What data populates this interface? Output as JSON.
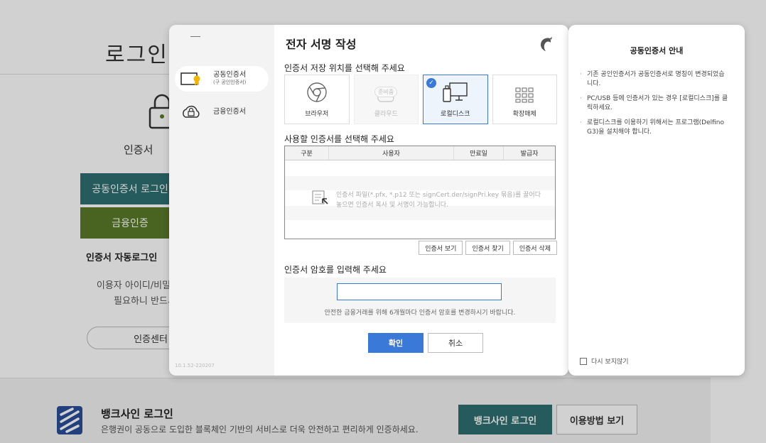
{
  "background": {
    "title": "로그인",
    "cert_label": "인증서",
    "joint_login_btn": "공동인증서 로그인",
    "fin_btn": "금융인증",
    "auto_login": "인증서 자동로그인",
    "desc_line1": "이용자 아이디/비밀번호",
    "desc_line2": "필요하니 반드시 기",
    "center_btn": "인증센터"
  },
  "banksign": {
    "title": "뱅크사인 로그인",
    "desc": "은행권이 공동으로 도입한 블록체인 기반의 서비스로 더욱 안전하고 편리하게 인증하세요.",
    "login_btn": "뱅크사인 로그인",
    "howto_btn": "이용방법 보기"
  },
  "sidebar": {
    "items": [
      {
        "label": "공동인증서",
        "sub": "(구 공인인증서)",
        "icon": "certificate-icon",
        "active": true
      },
      {
        "label": "금융인증서",
        "sub": "",
        "icon": "cloud-lock-icon",
        "active": false
      }
    ],
    "version": "10.1.52-220207"
  },
  "dialog": {
    "title": "전자 서명 작성",
    "store_label": "인증서 저장 위치를 선택해 주세요",
    "stores": [
      {
        "label": "브라우저",
        "icon": "browser-icon",
        "state": "normal"
      },
      {
        "label": "클라우드",
        "icon": "cloud-icon",
        "state": "disabled",
        "badge": "준비중"
      },
      {
        "label": "로컬디스크",
        "icon": "local-disk-icon",
        "state": "selected"
      },
      {
        "label": "확장매체",
        "icon": "grid-icon",
        "state": "normal"
      }
    ],
    "select_label": "사용할 인증서를 선택해 주세요",
    "table_headers": [
      "구분",
      "사용자",
      "만료일",
      "발급자"
    ],
    "drop_hint": "인증서 파일(*.pfx, *.p12 또는 signCert.der/signPri.key 묶음)를 끌어다 놓으면 인증서 복사 및 서명이 가능합니다.",
    "buttons": {
      "view": "인증서 보기",
      "find": "인증서 찾기",
      "delete": "인증서 삭제"
    },
    "pw_label": "인증서 암호를 입력해 주세요",
    "pw_value": "",
    "pw_hint": "안전한 금융거래를 위해 6개월마다 인증서 암호를 변경하시기 바랍니다.",
    "ok": "확인",
    "cancel": "취소"
  },
  "info": {
    "title": "공동인증서 안내",
    "items": [
      "기존 공인인증서가 공동인증서로 명칭이 변경되었습니다.",
      "PC/USB 등에 인증서가 있는 경우 [로컬디스크]를 클릭하세요.",
      "로컬디스크를 이용하기 위해서는 프로그램(Delfino G3)을 설치해야 합니다."
    ],
    "dont_show": "다시 보지않기"
  },
  "colors": {
    "teal": "#2e6f71",
    "olive": "#5a7a28",
    "blue": "#3b79d8"
  }
}
